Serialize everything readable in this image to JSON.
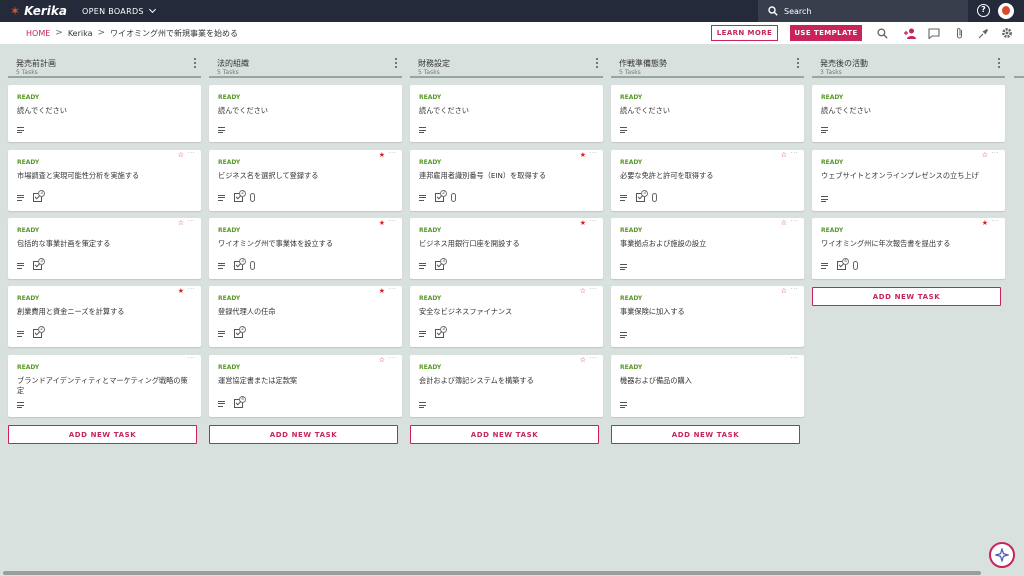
{
  "app": {
    "logo_text": "Kerika",
    "open_boards_label": "OPEN BOARDS"
  },
  "search": {
    "label": "Search"
  },
  "help_label": "?",
  "breadcrumb": {
    "home": "HOME",
    "sep": ">",
    "team": "Kerika",
    "board": "ワイオミング州で新規事業を始める"
  },
  "buttons": {
    "learn_more": "LEARN MORE",
    "use_template": "USE TEMPLATE"
  },
  "add_task_label": "ADD NEW TASK",
  "columns": [
    {
      "title": "発売前計画",
      "count": "5 Tasks",
      "cards": [
        {
          "status": "READY",
          "title": "読んでください",
          "star": "none",
          "checklist": null,
          "attachment": false
        },
        {
          "status": "READY",
          "title": "市場調査と実現可能性分析を実施する",
          "star": "off",
          "checklist": "3",
          "attachment": false
        },
        {
          "status": "READY",
          "title": "包括的な事業計画を策定する",
          "star": "off",
          "checklist": "3",
          "attachment": false
        },
        {
          "status": "READY",
          "title": "創業費用と資金ニーズを計算する",
          "star": "on",
          "checklist": "2",
          "attachment": false
        },
        {
          "status": "READY",
          "title": "ブランドアイデンティティとマーケティング戦略の策定",
          "star": "none",
          "checklist": null,
          "attachment": false
        }
      ]
    },
    {
      "title": "法的組織",
      "count": "5 Tasks",
      "cards": [
        {
          "status": "READY",
          "title": "読んでください",
          "star": "none",
          "checklist": null,
          "attachment": false
        },
        {
          "status": "READY",
          "title": "ビジネス名を選択して登録する",
          "star": "on",
          "checklist": "2",
          "attachment": true
        },
        {
          "status": "READY",
          "title": "ワイオミング州で事業体を設立する",
          "star": "on",
          "checklist": "3",
          "attachment": true
        },
        {
          "status": "READY",
          "title": "登録代理人の任命",
          "star": "on",
          "checklist": "2",
          "attachment": false
        },
        {
          "status": "READY",
          "title": "運営協定書または定款案",
          "star": "off",
          "checklist": "4",
          "attachment": false
        }
      ]
    },
    {
      "title": "財務設定",
      "count": "5 Tasks",
      "cards": [
        {
          "status": "READY",
          "title": "読んでください",
          "star": "none",
          "checklist": null,
          "attachment": false
        },
        {
          "status": "READY",
          "title": "連邦雇用者識別番号（EIN）を取得する",
          "star": "on",
          "checklist": "2",
          "attachment": true
        },
        {
          "status": "READY",
          "title": "ビジネス用銀行口座を開設する",
          "star": "on",
          "checklist": "3",
          "attachment": false
        },
        {
          "status": "READY",
          "title": "安全なビジネスファイナンス",
          "star": "off",
          "checklist": "3",
          "attachment": false
        },
        {
          "status": "READY",
          "title": "会計および簿記システムを構築する",
          "star": "off",
          "checklist": null,
          "attachment": false
        }
      ]
    },
    {
      "title": "作戦準備態勢",
      "count": "5 Tasks",
      "cards": [
        {
          "status": "READY",
          "title": "読んでください",
          "star": "none",
          "checklist": null,
          "attachment": false
        },
        {
          "status": "READY",
          "title": "必要な免許と許可を取得する",
          "star": "off",
          "checklist": "3",
          "attachment": true
        },
        {
          "status": "READY",
          "title": "事業拠点および施設の設立",
          "star": "off",
          "checklist": null,
          "attachment": false
        },
        {
          "status": "READY",
          "title": "事業保険に加入する",
          "star": "off",
          "checklist": null,
          "attachment": false
        },
        {
          "status": "READY",
          "title": "機器および備品の購入",
          "star": "none",
          "checklist": null,
          "attachment": false
        }
      ]
    },
    {
      "title": "発売後の活動",
      "count": "3 Tasks",
      "cards": [
        {
          "status": "READY",
          "title": "読んでください",
          "star": "none",
          "checklist": null,
          "attachment": false
        },
        {
          "status": "READY",
          "title": "ウェブサイトとオンラインプレゼンスの立ち上げ",
          "star": "off",
          "checklist": null,
          "attachment": false
        },
        {
          "status": "READY",
          "title": "ワイオミング州に年次報告書を提出する",
          "star": "on",
          "checklist": "4",
          "attachment": true
        }
      ]
    }
  ],
  "colors": {
    "accent": "#c8245a",
    "topbar": "#242a3a",
    "board_bg": "#d9e1de",
    "ready": "#5a9a2a",
    "star": "#e02020"
  },
  "icons": [
    "search-icon",
    "add-member-icon",
    "chat-icon",
    "attachment-icon",
    "pin-icon",
    "settings-icon",
    "assistant-icon"
  ]
}
